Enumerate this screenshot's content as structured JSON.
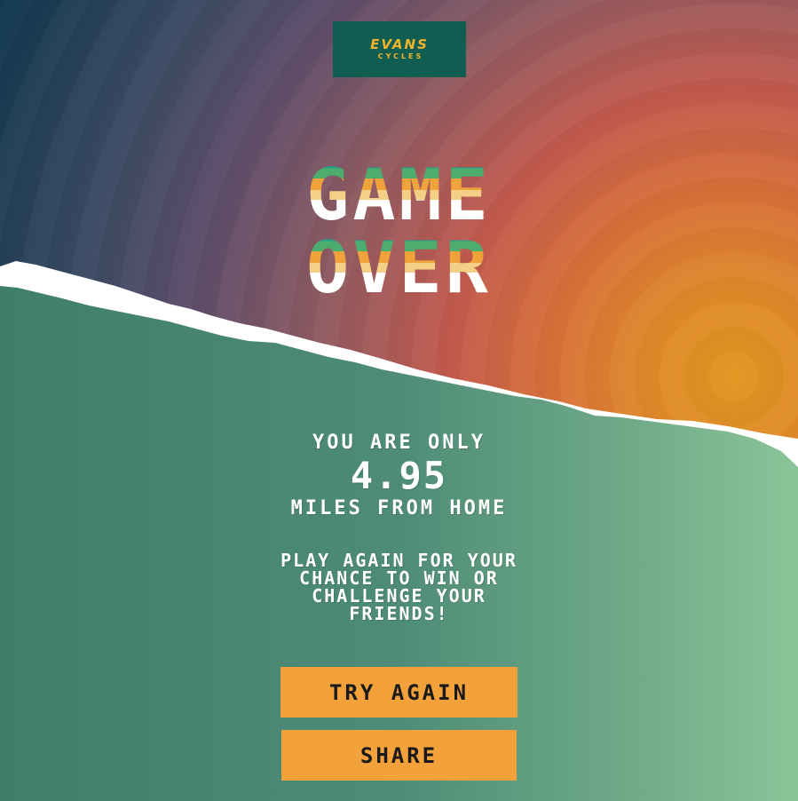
{
  "brand": {
    "name": "EVANS",
    "sub": "CYCLES",
    "bg_color": "#0f5e51",
    "text_color": "#f1b32b"
  },
  "title": {
    "line1": "GAME",
    "line2": "OVER"
  },
  "result": {
    "prefix": "YOU ARE ONLY",
    "miles": "4.95",
    "suffix": "MILES FROM HOME"
  },
  "promo": {
    "lines": [
      "PLAY AGAIN FOR YOUR",
      "CHANCE TO WIN OR",
      "CHALLENGE YOUR",
      "FRIENDS!"
    ]
  },
  "buttons": {
    "try_again": "TRY AGAIN",
    "share": "SHARE",
    "color": "#f3a13b"
  },
  "colors": {
    "ground_dark": "#3f7e6b",
    "ground_light": "#8bc498",
    "road": "#ffffff",
    "sky_hot": "#e2951f",
    "sky_dark": "#133850"
  }
}
